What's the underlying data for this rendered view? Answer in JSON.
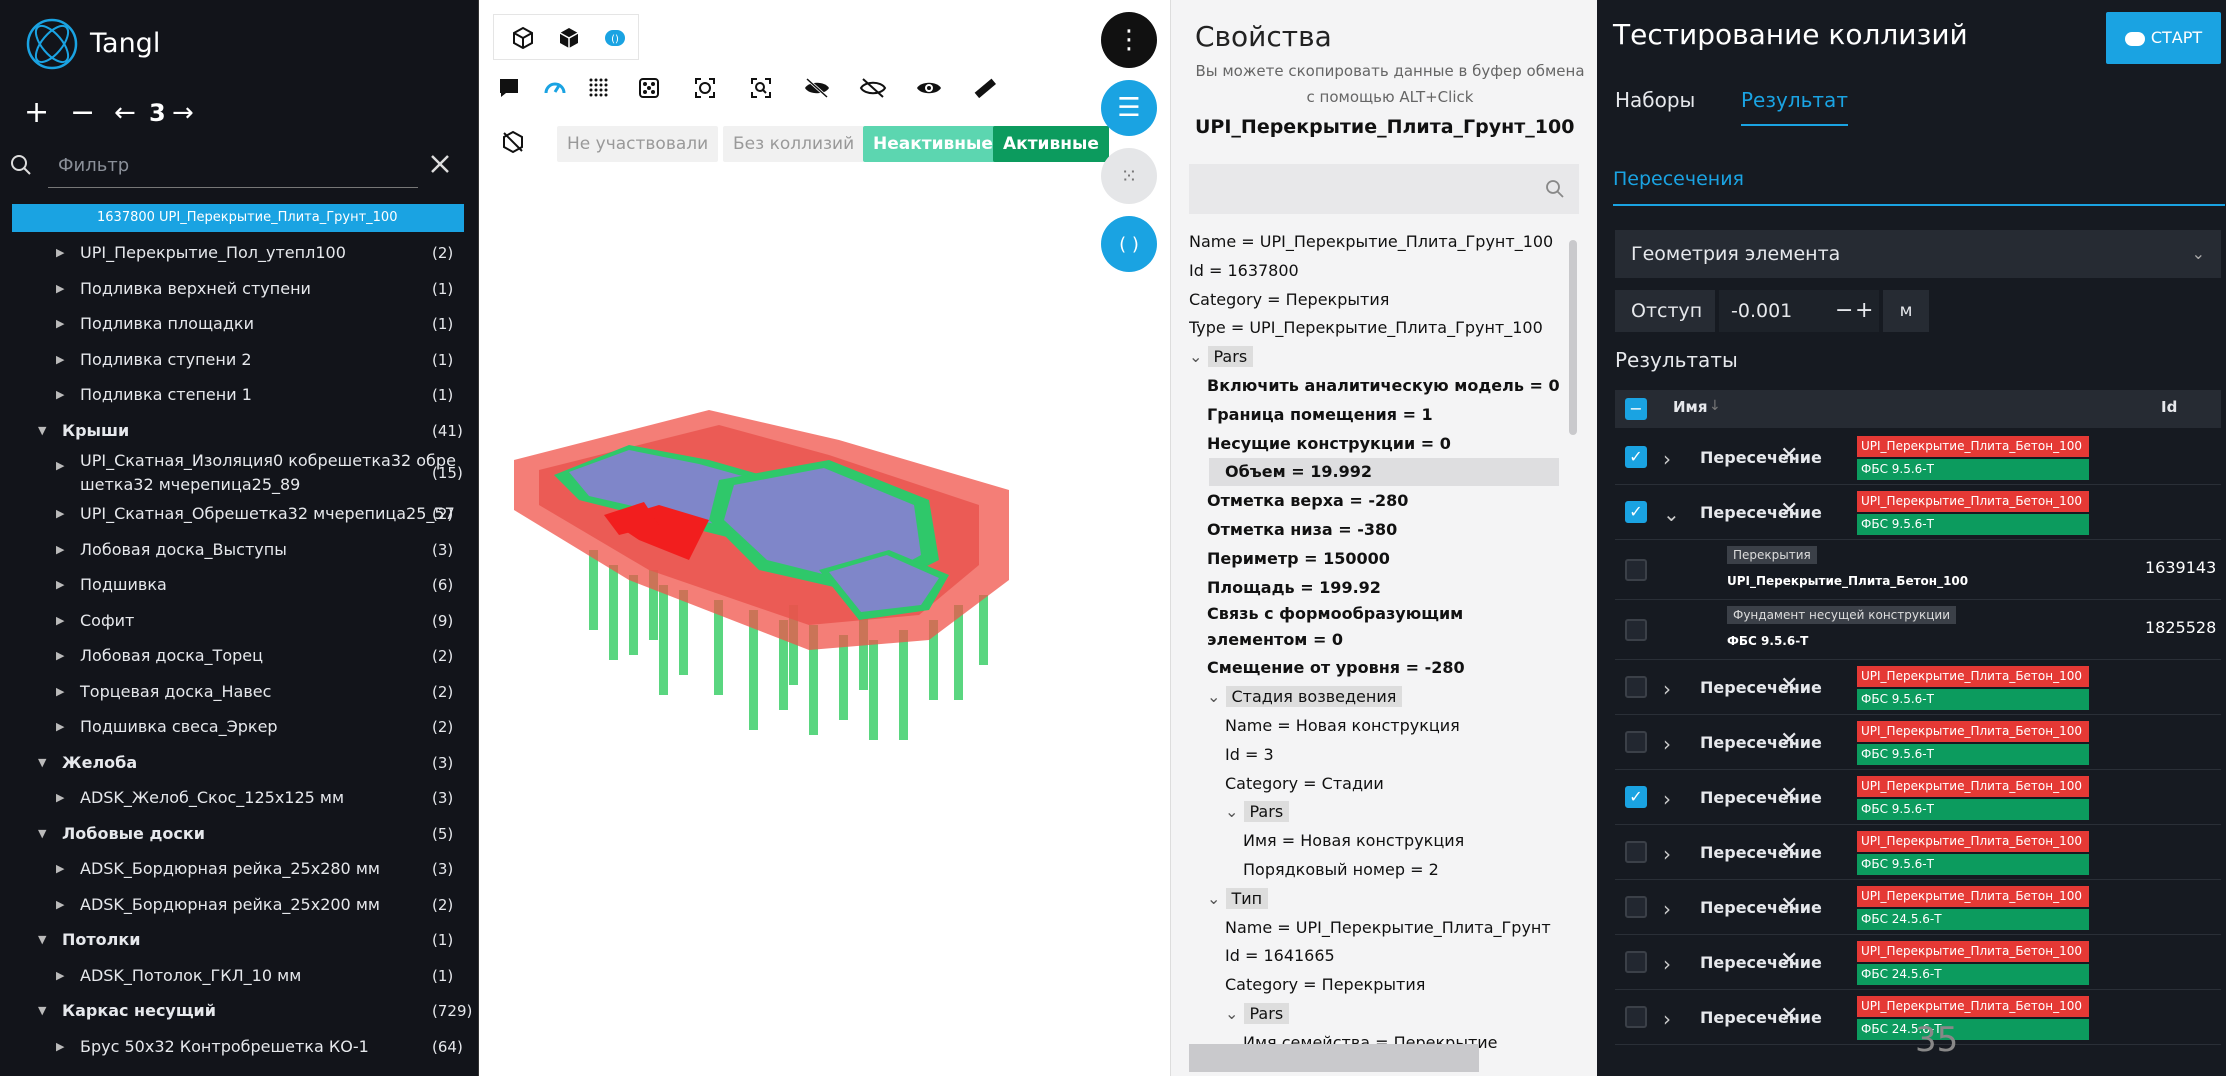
{
  "left": {
    "brand": "Tangl",
    "nav": {
      "plus": "+",
      "minus": "−",
      "back": "←",
      "level": "3",
      "fwd": "→"
    },
    "filter_placeholder": "Фильтр",
    "selected": "1637800  UPI_Перекрытие_Плита_Грунт_100",
    "tree": [
      {
        "label": "UPI_Перекрытие_Пол_утепл100",
        "count": "(2)",
        "level": 1
      },
      {
        "label": "Подливка верхней ступени",
        "count": "(1)",
        "level": 1
      },
      {
        "label": "Подливка площадки",
        "count": "(1)",
        "level": 1
      },
      {
        "label": "Подливка ступени 2",
        "count": "(1)",
        "level": 1
      },
      {
        "label": "Подливка степени 1",
        "count": "(1)",
        "level": 1
      },
      {
        "label": "Крыши",
        "count": "(41)",
        "level": 0
      },
      {
        "label": "UPI_Скатная_Изоляция0 кобрешетка32 обре",
        "label2": "шетка32 мчерепица25_89",
        "count": "(15)",
        "level": 1
      },
      {
        "label": "UPI_Скатная_Обрешетка32 мчерепица25_57",
        "count": "(2)",
        "level": 1
      },
      {
        "label": "Лобовая доска_Выступы",
        "count": "(3)",
        "level": 1
      },
      {
        "label": "Подшивка",
        "count": "(6)",
        "level": 1
      },
      {
        "label": "Софит",
        "count": "(9)",
        "level": 1
      },
      {
        "label": "Лобовая доска_Торец",
        "count": "(2)",
        "level": 1
      },
      {
        "label": "Торцевая доска_Навес",
        "count": "(2)",
        "level": 1
      },
      {
        "label": "Подшивка свеса_Эркер",
        "count": "(2)",
        "level": 1
      },
      {
        "label": "Желоба",
        "count": "(3)",
        "level": 0
      },
      {
        "label": "ADSK_Желоб_Скос_125x125 мм",
        "count": "(3)",
        "level": 1
      },
      {
        "label": "Лобовые доски",
        "count": "(5)",
        "level": 0
      },
      {
        "label": "ADSK_Бордюрная рейка_25x280 мм",
        "count": "(3)",
        "level": 1
      },
      {
        "label": "ADSK_Бордюрная рейка_25x200 мм",
        "count": "(2)",
        "level": 1
      },
      {
        "label": "Потолки",
        "count": "(1)",
        "level": 0
      },
      {
        "label": "ADSK_Потолок_ГКЛ_10 мм",
        "count": "(1)",
        "level": 1
      },
      {
        "label": "Каркас несущий",
        "count": "(729)",
        "level": 0
      },
      {
        "label": "Брус 50x32 Контробрешетка КО-1",
        "count": "(64)",
        "level": 1
      }
    ]
  },
  "viewer": {
    "pills": {
      "not_part": "Не участвовали",
      "no_coll": "Без коллизий",
      "inactive": "Неактивные",
      "active": "Активные"
    },
    "colors": {
      "inactive": "#5cd6b0",
      "active": "#0c9b5e",
      "accent": "#1aa3e2"
    }
  },
  "props": {
    "title": "Свойства",
    "hint": "Вы можете скопировать данные в буфер обмена с помощью ALT+Click",
    "name": "UPI_Перекрытие_Плита_Грунт_100",
    "rows": [
      {
        "text": "Name = UPI_Перекрытие_Плита_Грунт_100",
        "indent": 0
      },
      {
        "text": "Id = 1637800",
        "indent": 0
      },
      {
        "text": "Category = Перекрытия",
        "indent": 0
      },
      {
        "text": "Type = UPI_Перекрытие_Плита_Грунт_100",
        "indent": 0
      },
      {
        "text": "Pars",
        "indent": 0,
        "group": true
      },
      {
        "text": "Включить аналитическую модель = 0",
        "indent": 1
      },
      {
        "text": "Граница помещения = 1",
        "indent": 1
      },
      {
        "text": "Несущие конструкции = 0",
        "indent": 1
      },
      {
        "text": "Объем = 19.992",
        "indent": 1,
        "hl": true
      },
      {
        "text": "Отметка верха = -280",
        "indent": 1
      },
      {
        "text": "Отметка низа = -380",
        "indent": 1
      },
      {
        "text": "Периметр = 150000",
        "indent": 1
      },
      {
        "text": "Площадь = 199.92",
        "indent": 1
      },
      {
        "text": "Связь с формообразующим",
        "indent": 1
      },
      {
        "text": "элементом = 0",
        "indent": 1
      },
      {
        "text": "Смещение от уровня = -280",
        "indent": 1
      },
      {
        "text": "Стадия возведения",
        "indent": 1,
        "group": true
      },
      {
        "text": "Name = Новая конструкция",
        "indent": 2
      },
      {
        "text": "Id = 3",
        "indent": 2
      },
      {
        "text": "Category = Стадии",
        "indent": 2
      },
      {
        "text": "Pars",
        "indent": 2,
        "group": true
      },
      {
        "text": "Имя = Новая конструкция",
        "indent": 3
      },
      {
        "text": "Порядковый номер = 2",
        "indent": 3
      },
      {
        "text": "Тип",
        "indent": 1,
        "group": true
      },
      {
        "text": "Name = UPI_Перекрытие_Плита_Грунт",
        "indent": 2
      },
      {
        "text": "Id = 1641665",
        "indent": 2
      },
      {
        "text": "Category = Перекрытия",
        "indent": 2
      },
      {
        "text": "Pars",
        "indent": 2,
        "group": true
      },
      {
        "text": "Имя семейства = Перекрытие",
        "indent": 3
      }
    ]
  },
  "coll": {
    "title": "Тестирование коллизий",
    "start": "СТАРТ",
    "tabs": [
      "Наборы",
      "Результат"
    ],
    "sub": "Пересечения",
    "geometry": "Геометрия элемента",
    "offset_label": "Отступ",
    "offset_value": "-0.001",
    "unit": "м",
    "results_label": "Результаты",
    "col_name": "Имя",
    "col_id": "Id",
    "rows": [
      {
        "checked": true,
        "expanded": false,
        "name": "Пересечение",
        "a": "UPI_Перекрытие_Плита_Бетон_100",
        "b": "ФБС 9.5.6-Т"
      },
      {
        "checked": true,
        "expanded": true,
        "name": "Пересечение",
        "a": "UPI_Перекрытие_Плита_Бетон_100",
        "b": "ФБС 9.5.6-Т"
      },
      {
        "checked": false,
        "expanded": false,
        "name": "Пересечение",
        "a": "UPI_Перекрытие_Плита_Бетон_100",
        "b": "ФБС 9.5.6-Т"
      },
      {
        "checked": false,
        "expanded": false,
        "name": "Пересечение",
        "a": "UPI_Перекрытие_Плита_Бетон_100",
        "b": "ФБС 9.5.6-Т"
      },
      {
        "checked": true,
        "expanded": false,
        "name": "Пересечение",
        "a": "UPI_Перекрытие_Плита_Бетон_100",
        "b": "ФБС 9.5.6-Т"
      },
      {
        "checked": false,
        "expanded": false,
        "name": "Пересечение",
        "a": "UPI_Перекрытие_Плита_Бетон_100",
        "b": "ФБС 9.5.6-Т"
      },
      {
        "checked": false,
        "expanded": false,
        "name": "Пересечение",
        "a": "UPI_Перекрытие_Плита_Бетон_100",
        "b": "ФБС 24.5.6-Т"
      },
      {
        "checked": false,
        "expanded": false,
        "name": "Пересечение",
        "a": "UPI_Перекрытие_Плита_Бетон_100",
        "b": "ФБС 24.5.6-Т"
      },
      {
        "checked": false,
        "expanded": false,
        "name": "Пересечение",
        "a": "UPI_Перекрытие_Плита_Бетон_100",
        "b": "ФБС 24.5.6-Т"
      }
    ],
    "detail": [
      {
        "cat": "Перекрытия",
        "name": "UPI_Перекрытие_Плита_Бетон_100",
        "id": "1639143"
      },
      {
        "cat": "Фундамент несущей конструкции",
        "name": "ФБС 9.5.6-Т",
        "id": "1825528"
      }
    ]
  },
  "slide_number": "35"
}
